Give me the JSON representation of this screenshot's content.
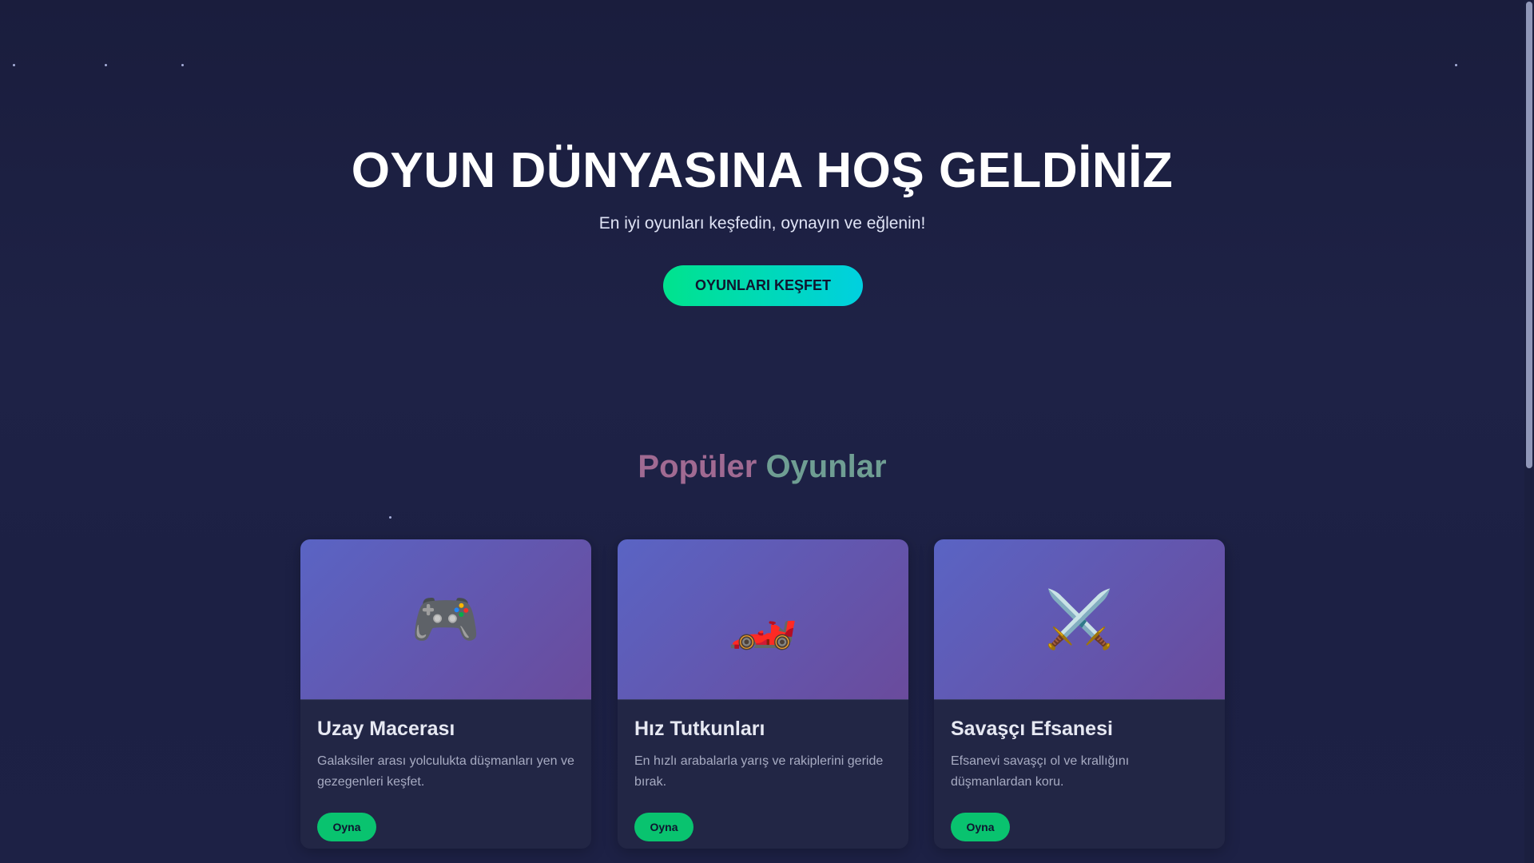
{
  "hero": {
    "title": "OYUN DÜNYASINA HOŞ GELDİNİZ",
    "subtitle": "En iyi oyunları keşfedin, oynayın ve eğlenin!",
    "cta_label": "OYUNLARI KEŞFET"
  },
  "popular": {
    "title_word1": "Popüler",
    "title_word2": "Oyunlar",
    "games": [
      {
        "icon": "gamepad-icon",
        "glyph": "🎮",
        "title": "Uzay Macerası",
        "description": "Galaksiler arası yolculukta düşmanları yen ve gezegenleri keşfet.",
        "button_label": "Oyna"
      },
      {
        "icon": "race-car-icon",
        "glyph": "🏎️",
        "title": "Hız Tutkunları",
        "description": "En hızlı arabalarla yarış ve rakiplerini geride bırak.",
        "button_label": "Oyna"
      },
      {
        "icon": "crossed-swords-icon",
        "glyph": "⚔️",
        "title": "Savaşçı Efsanesi",
        "description": "Efsanevi savaşçı ol ve krallığını düşmanlardan koru.",
        "button_label": "Oyna"
      }
    ]
  },
  "colors": {
    "background": "#1b1f3f",
    "accent_start": "#00e38d",
    "accent_end": "#00d0e0",
    "play_button": "#09c36f"
  }
}
